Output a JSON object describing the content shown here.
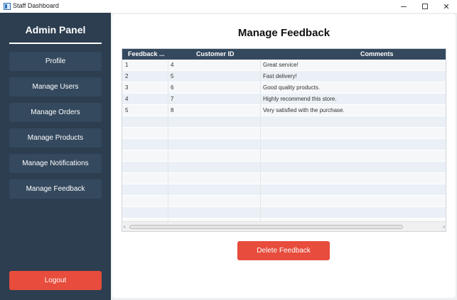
{
  "window": {
    "title": "Staff Dashboard",
    "minimize_label": "",
    "maximize_label": "",
    "close_label": "✕"
  },
  "sidebar": {
    "title": "Admin Panel",
    "items": [
      {
        "label": "Profile"
      },
      {
        "label": "Manage Users"
      },
      {
        "label": "Manage Orders"
      },
      {
        "label": "Manage Products"
      },
      {
        "label": "Manage Notifications"
      },
      {
        "label": "Manage Feedback"
      }
    ],
    "logout_label": "Logout"
  },
  "main": {
    "title": "Manage Feedback",
    "table": {
      "columns": [
        "Feedback ...",
        "Customer ID",
        "Comments"
      ],
      "rows": [
        {
          "id": "1",
          "customer_id": "4",
          "comment": "Great service!"
        },
        {
          "id": "2",
          "customer_id": "5",
          "comment": "Fast delivery!"
        },
        {
          "id": "3",
          "customer_id": "6",
          "comment": "Good quality products."
        },
        {
          "id": "4",
          "customer_id": "7",
          "comment": "Highly recommend this store."
        },
        {
          "id": "5",
          "customer_id": "8",
          "comment": "Very satisfied with the purchase."
        }
      ]
    },
    "delete_label": "Delete Feedback"
  },
  "colors": {
    "sidebar_bg": "#2c3e50",
    "nav_button_bg": "#34495e",
    "accent_red": "#e74c3c",
    "table_header_bg": "#34495e"
  }
}
